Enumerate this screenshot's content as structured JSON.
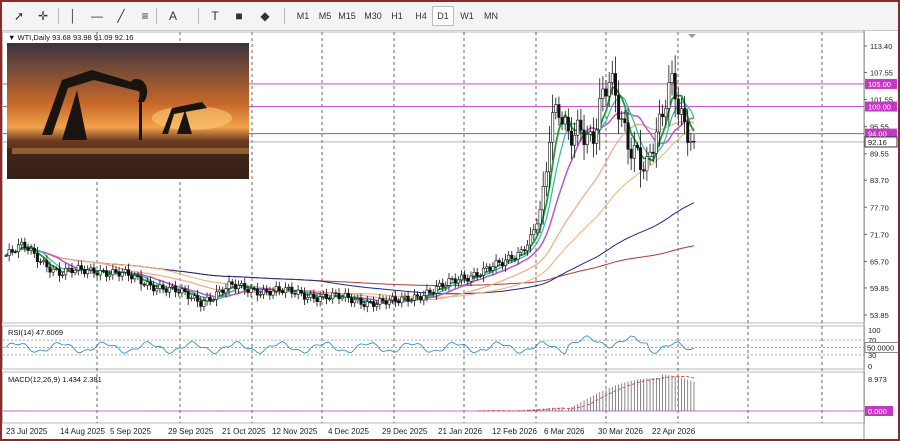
{
  "toolbar": {
    "tools": [
      {
        "name": "cursor-icon",
        "glyph": "➚"
      },
      {
        "name": "crosshair-icon",
        "glyph": "✛"
      },
      {
        "name": "vertical-line-icon",
        "glyph": "│"
      },
      {
        "name": "horizontal-line-icon",
        "glyph": "—"
      },
      {
        "name": "trend-line-icon",
        "glyph": "╱"
      },
      {
        "name": "fibonacci-icon",
        "glyph": "≡"
      },
      {
        "name": "text-icon",
        "glyph": "A"
      },
      {
        "name": "label-icon",
        "glyph": "T"
      },
      {
        "name": "rectangle-icon",
        "glyph": "■"
      },
      {
        "name": "shapes-icon",
        "glyph": "◆"
      }
    ],
    "timeframes": [
      "M1",
      "M5",
      "M15",
      "M30",
      "H1",
      "H4",
      "D1",
      "W1",
      "MN"
    ],
    "active_timeframe": "D1"
  },
  "main": {
    "header": "▼ WTI,Daily  93.68 93.98 91.09 92.16",
    "price_levels": [
      "113.40",
      "107.55",
      "101.55",
      "95.55",
      "89.55",
      "83.70",
      "77.70",
      "71.70",
      "65.70",
      "59.85",
      "53.85"
    ],
    "tags": [
      {
        "label": "105.00",
        "price": 105.0,
        "color": "#c637c6"
      },
      {
        "label": "100.00",
        "price": 100.0,
        "color": "#c637c6"
      },
      {
        "label": "94.00",
        "price": 94.0,
        "color": "#c637c6"
      },
      {
        "label": "92.16",
        "price": 92.16,
        "color": "#333333"
      }
    ],
    "dates": [
      "23 Jul 2025",
      "14 Aug 2025",
      "5 Sep 2025",
      "29 Sep 2025",
      "21 Oct 2025",
      "12 Nov 2025",
      "4 Dec 2025",
      "29 Dec 2025",
      "21 Jan 2026",
      "12 Feb 2026",
      "6 Mar 2026",
      "30 Mar 2026",
      "22 Apr 2026"
    ]
  },
  "rsi": {
    "header": "RSI(14) 47.6069",
    "levels": [
      "100",
      "70",
      "30",
      "0"
    ],
    "tag": "50.0000"
  },
  "macd": {
    "header": "MACD(12,26,9) 1.434 2.381",
    "levels": [
      "8.973"
    ],
    "tag": "0.000"
  },
  "colors": {
    "candle": "#111111",
    "sma_fast": "#1a9e34",
    "sma_mid": "#bb55cc",
    "sma_teal": "#2fb7a3",
    "sma_peach": "#f2a98a",
    "sma_orange": "#f0b070",
    "sma_navy": "#1c2a8c",
    "sma_maroon": "#b23838",
    "level_line": "#c637c6",
    "rsi_line": "#1e88c8",
    "macd_signal": "#d63b3b"
  }
}
